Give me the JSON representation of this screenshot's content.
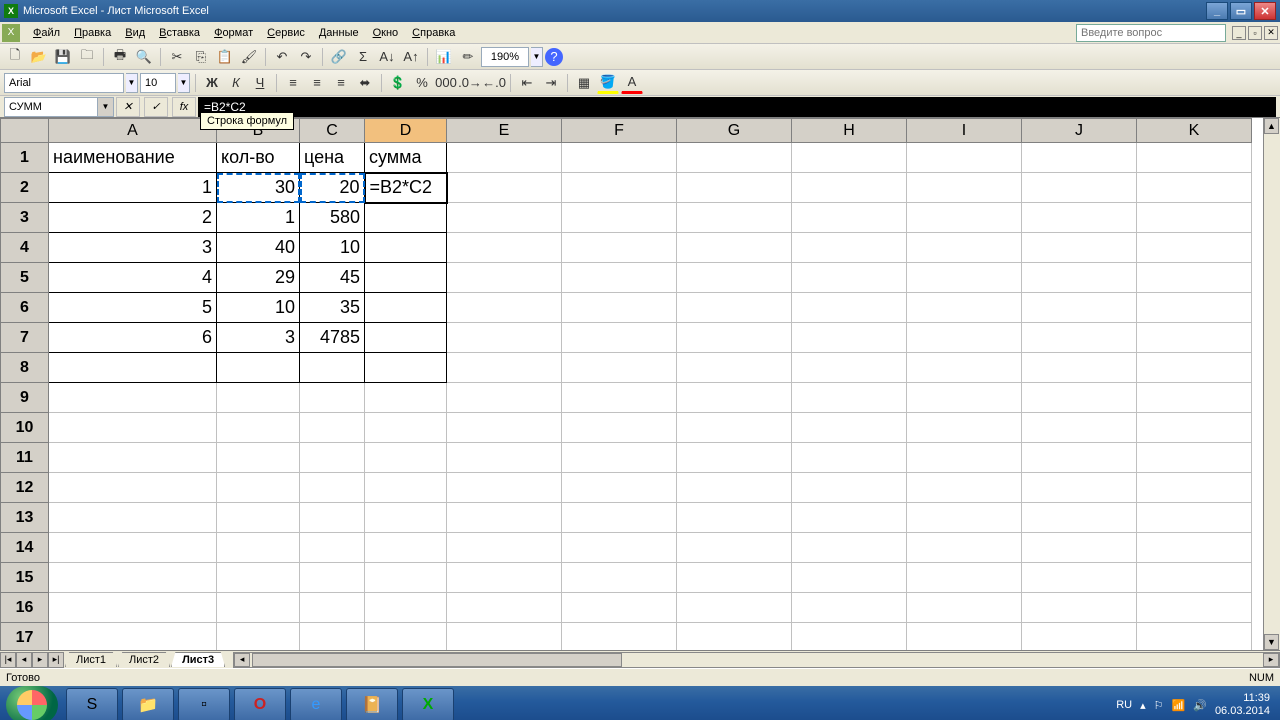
{
  "title": "Microsoft Excel - Лист Microsoft Excel",
  "menu": [
    "Файл",
    "Правка",
    "Вид",
    "Вставка",
    "Формат",
    "Сервис",
    "Данные",
    "Окно",
    "Справка"
  ],
  "ask_placeholder": "Введите вопрос",
  "font": {
    "name": "Arial",
    "size": "10"
  },
  "zoom": "190%",
  "namebox": "СУММ",
  "formula": "=B2*C2",
  "tooltip": "Строка формул",
  "columns": [
    "A",
    "B",
    "C",
    "D",
    "E",
    "F",
    "G",
    "H",
    "I",
    "J",
    "K"
  ],
  "col_widths": {
    "A": 168,
    "B": 83,
    "C": 65,
    "D": 82,
    "E": 115,
    "F": 115,
    "G": 115,
    "H": 115,
    "I": 115,
    "J": 115,
    "K": 115
  },
  "active_col": "D",
  "rows_count": 17,
  "headers": {
    "A": "наименование",
    "B": "кол-во",
    "C": "цена",
    "D": "сумма"
  },
  "data": {
    "2": {
      "A": "1",
      "B": "30",
      "C": "20",
      "D": "=B2*C2"
    },
    "3": {
      "A": "2",
      "B": "1",
      "C": "580"
    },
    "4": {
      "A": "3",
      "B": "40",
      "C": "10"
    },
    "5": {
      "A": "4",
      "B": "29",
      "C": "45"
    },
    "6": {
      "A": "5",
      "B": "10",
      "C": "35"
    },
    "7": {
      "A": "6",
      "B": "3",
      "C": "4785"
    }
  },
  "editing_cell": "D2",
  "ref_range": "B2:C2",
  "sheets": [
    "Лист1",
    "Лист2",
    "Лист3"
  ],
  "active_sheet": "Лист3",
  "status": "Готово",
  "status_right": "NUM",
  "tray": {
    "lang": "RU",
    "time": "11:39",
    "date": "06.03.2014"
  }
}
